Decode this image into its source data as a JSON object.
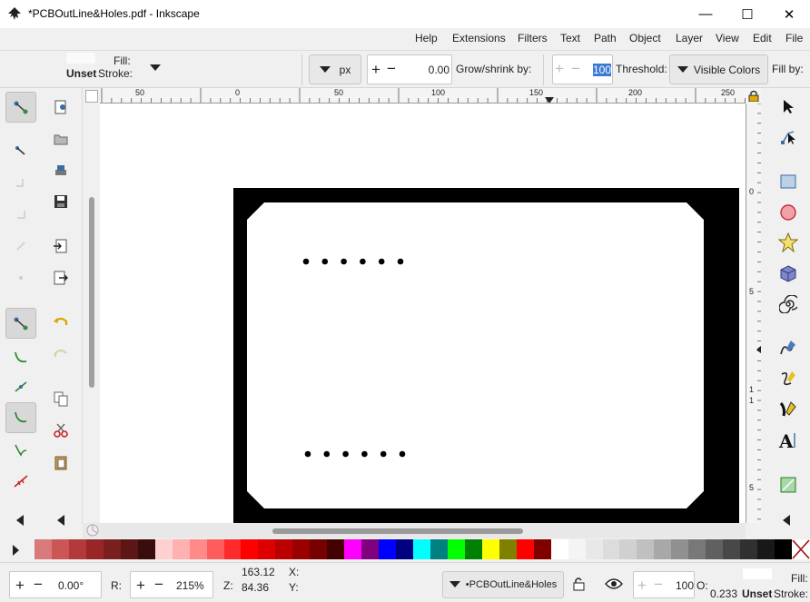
{
  "window": {
    "title": "*PCBOutLine&Holes.pdf - Inkscape",
    "minimize": "—",
    "maximize": "☐",
    "close": "✕"
  },
  "menu": [
    "Help",
    "Extensions",
    "Filters",
    "Text",
    "Path",
    "Object",
    "Layer",
    "View",
    "Edit",
    "File"
  ],
  "controls": {
    "fill_label": "Fill:",
    "unset_label": "Unset",
    "stroke_label": "Stroke:",
    "unit": "px",
    "grow_value": "0.00",
    "grow_label": "Grow/shrink by:",
    "threshold_value": "100",
    "threshold_label": "Threshold:",
    "fill_by_value": "Visible Colors",
    "fill_by_label": "Fill by:"
  },
  "ruler": {
    "h_ticks": [
      "50",
      "0",
      "50",
      "100",
      "150",
      "200",
      "250"
    ],
    "v_ticks": [
      "0",
      "5",
      "1",
      "1",
      "5"
    ]
  },
  "status": {
    "rotation": "0.00°",
    "r_label": "R:",
    "zoom": "215%",
    "z_label": "Z:",
    "x_value": "163.12",
    "y_value": "84.36",
    "x_label": "X:",
    "y_label": "Y:",
    "layer": "•PCBOutLine&Holes",
    "opacity": "100",
    "o_label": "O:",
    "fill_label": "Fill:",
    "stroke_value": "0.233",
    "unset_label": "Unset",
    "stroke_label": "Stroke:"
  },
  "palette_colors": [
    "#d97a7a",
    "#cc5555",
    "#b33a3a",
    "#992626",
    "#7a1f1f",
    "#5c1616",
    "#3a0d0d",
    "#ffd0d0",
    "#ffb0b0",
    "#ff8a8a",
    "#ff5c5c",
    "#ff2a2a",
    "#ff0000",
    "#dd0000",
    "#bb0000",
    "#990000",
    "#770000",
    "#440000",
    "#ff00ff",
    "#800080",
    "#0000ff",
    "#000080",
    "#00ffff",
    "#008080",
    "#00ff00",
    "#008000",
    "#ffff00",
    "#808000",
    "#ff0000",
    "#800000",
    "#ffffff",
    "#f4f4f4",
    "#e8e8e8",
    "#dcdcdc",
    "#d0d0d0",
    "#c0c0c0",
    "#a8a8a8",
    "#909090",
    "#787878",
    "#606060",
    "#484848",
    "#303030",
    "#181818",
    "#000000"
  ]
}
